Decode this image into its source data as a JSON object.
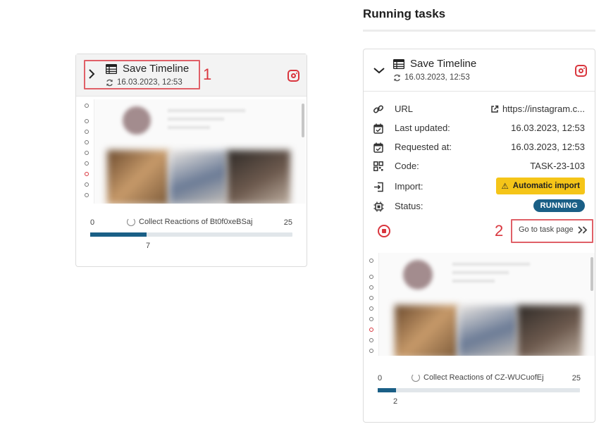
{
  "left_card": {
    "title": "Save Timeline",
    "date": "16.03.2023, 12:53",
    "callout": "1",
    "icons": {
      "expand": "chevron-right-icon",
      "type": "table-icon",
      "refresh": "refresh-icon",
      "platform": "instagram-icon"
    },
    "progress": {
      "min": "0",
      "max": "25",
      "label": "Collect Reactions of Bt0f0xeBSaj",
      "current": "7",
      "fraction": 0.28
    }
  },
  "right_panel": {
    "heading": "Running tasks",
    "card": {
      "title": "Save Timeline",
      "date": "16.03.2023, 12:53",
      "icons": {
        "collapse": "chevron-down-icon",
        "type": "table-icon",
        "refresh": "refresh-icon",
        "platform": "instagram-icon"
      },
      "rows": [
        {
          "label": "URL",
          "value": "https://instagram.c...",
          "icon": "link-icon"
        },
        {
          "label": "Last updated:",
          "value": "16.03.2023, 12:53",
          "icon": "calendar-check-icon"
        },
        {
          "label": "Requested at:",
          "value": "16.03.2023, 12:53",
          "icon": "calendar-check-icon"
        },
        {
          "label": "Code:",
          "value": "TASK-23-103",
          "icon": "qr-code-icon"
        },
        {
          "label": "Import:",
          "value": "Automatic import",
          "icon": "import-icon"
        },
        {
          "label": "Status:",
          "value": "RUNNING",
          "icon": "chip-icon"
        }
      ],
      "callout": "2",
      "goto_label": "Go to task page",
      "progress": {
        "min": "0",
        "max": "25",
        "label": "Collect Reactions of CZ-WUCuofEj",
        "current": "2",
        "fraction": 0.09
      }
    }
  },
  "colors": {
    "accent_red": "#d9363e",
    "progress": "#1a5f86",
    "import_badge": "#f5c518",
    "status_badge": "#1a5f86"
  }
}
